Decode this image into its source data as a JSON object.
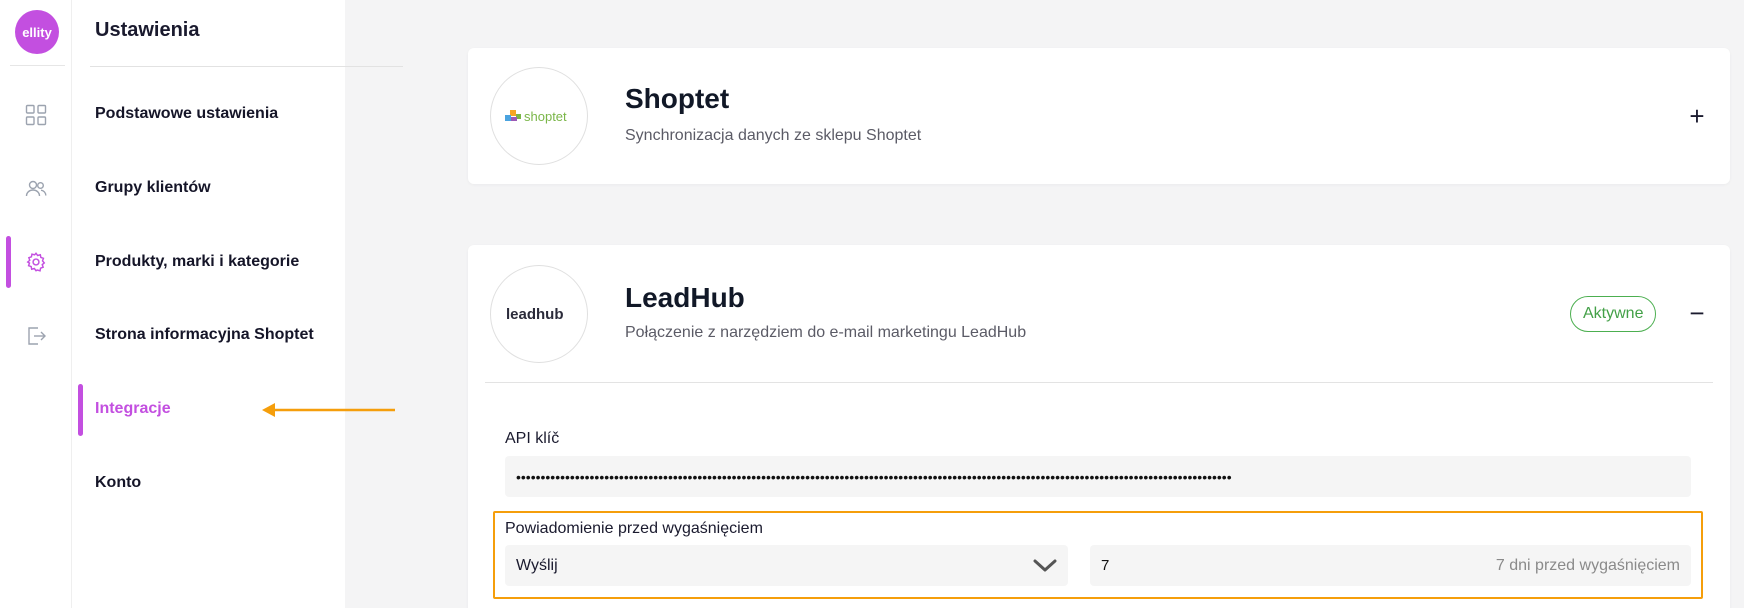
{
  "brand": {
    "logo_text": "ellity",
    "accent": "#c34fe0",
    "highlight": "#f59e0b"
  },
  "rail": {
    "items": [
      {
        "name": "dashboard-icon"
      },
      {
        "name": "users-icon"
      },
      {
        "name": "gear-icon",
        "active": true
      },
      {
        "name": "logout-icon"
      }
    ]
  },
  "nav": {
    "title": "Ustawienia",
    "items": [
      {
        "label": "Podstawowe ustawienia"
      },
      {
        "label": "Grupy klientów"
      },
      {
        "label": "Produkty, marki i kategorie"
      },
      {
        "label": "Strona informacyjna Shoptet"
      },
      {
        "label": "Integracje",
        "active": true
      },
      {
        "label": "Konto"
      }
    ]
  },
  "integrations": [
    {
      "logo_text": "shoptet",
      "title": "Shoptet",
      "subtitle": "Synchronizacja danych ze sklepu Shoptet",
      "toggle": "+"
    },
    {
      "logo_text": "leadhub",
      "title": "LeadHub",
      "subtitle": "Połączenie z narzędziem do e-mail marketingu LeadHub",
      "status": "Aktywne",
      "toggle": "−",
      "api_label": "API klíč",
      "api_value": "••••••••••••••••••••••••••••••••••••••••••••••••••••••••••••••••••••••••••••••••••••••••••••••••••••••••••••••••••••••••••••••••••••••••••••••••••",
      "notice_label": "Powiadomienie przed wygaśnięciem",
      "notice_select": "Wyślij",
      "notice_days": "7",
      "notice_days_hint": "7 dni przed wygaśnięciem"
    }
  ]
}
